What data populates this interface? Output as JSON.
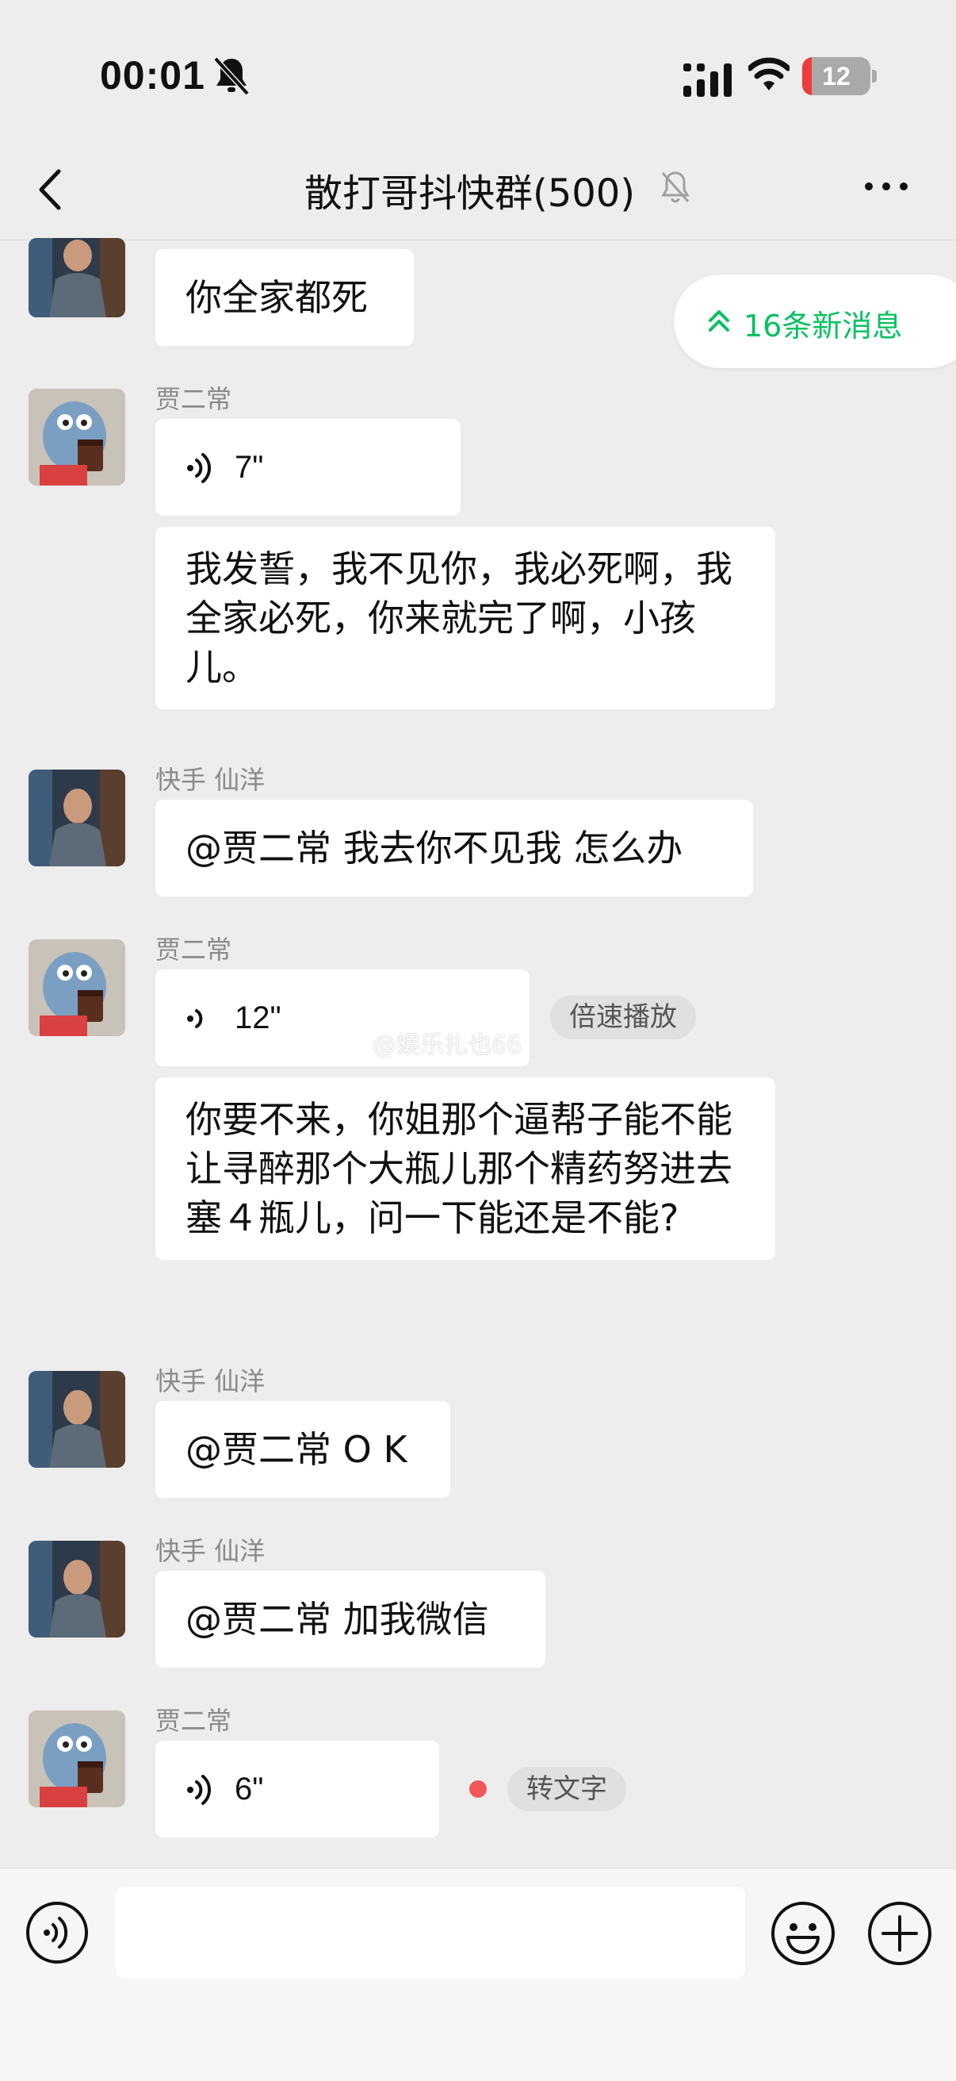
{
  "status_bar": {
    "time": "00:01",
    "battery": "12"
  },
  "nav": {
    "title": "散打哥抖快群(500)"
  },
  "new_messages_pill": "16条新消息",
  "messages": [
    {
      "text": "你全家都死"
    },
    {
      "sender": "贾二常",
      "voice_duration": "7\""
    },
    {
      "text": "我发誓，我不见你，我必死啊，我全家必死，你来就完了啊，小孩儿。"
    },
    {
      "sender": "快手 仙洋",
      "text": "@贾二常 我去你不见我 怎么办"
    },
    {
      "sender": "贾二常",
      "voice_duration": "12\"",
      "chip": "倍速播放"
    },
    {
      "text": "你要不来，你姐那个逼帮子能不能让寻醉那个大瓶儿那个精药努进去塞４瓶儿，问一下能还是不能?"
    },
    {
      "sender": "快手 仙洋",
      "text": "@贾二常 O K"
    },
    {
      "sender": "快手 仙洋",
      "text": "@贾二常 加我微信"
    },
    {
      "sender": "贾二常",
      "voice_duration": "6\"",
      "chip": "转文字"
    }
  ],
  "watermark": "@娱乐扎也66",
  "colors": {
    "accent_green": "#07c160",
    "bg": "#ededed",
    "bubble": "#ffffff"
  }
}
